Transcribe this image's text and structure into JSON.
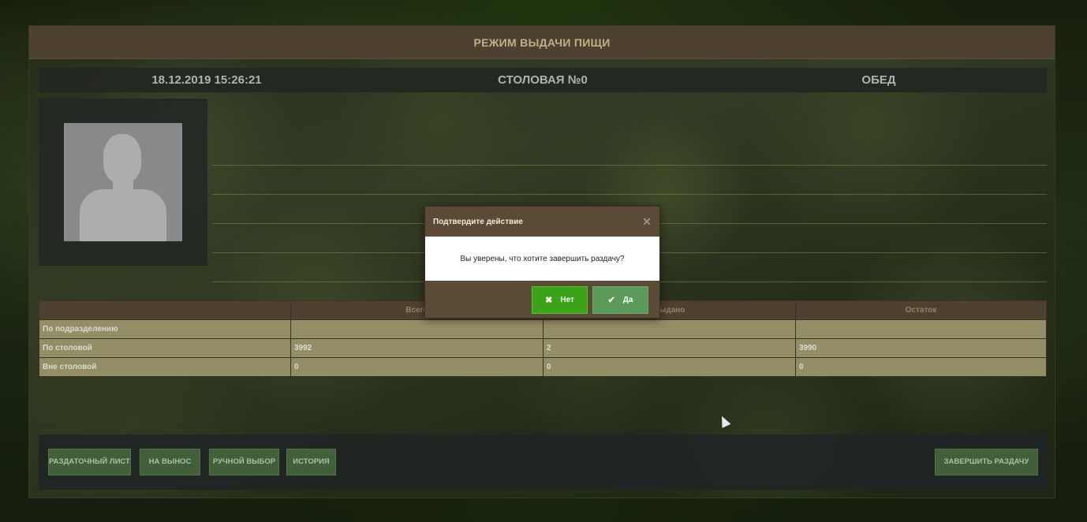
{
  "app": {
    "title": "РЕЖИМ ВЫДАЧИ ПИЩИ"
  },
  "info_bar": {
    "datetime": "18.12.2019 15:26:21",
    "canteen": "СТОЛОВАЯ №0",
    "meal": "ОБЕД"
  },
  "photo": {
    "icon": "user-silhouette-icon"
  },
  "table": {
    "headers": [
      "",
      "Всего",
      "Выдано",
      "Остаток"
    ],
    "rows": [
      {
        "label": "По подразделению",
        "total": "",
        "issued": "",
        "remainder": ""
      },
      {
        "label": "По столовой",
        "total": "3992",
        "issued": "2",
        "remainder": "3990"
      },
      {
        "label": "Вне столовой",
        "total": "0",
        "issued": "0",
        "remainder": "0"
      }
    ]
  },
  "buttons": {
    "distribution_sheet": "РАЗДАТОЧНЫЙ ЛИСТ",
    "takeaway": "НА ВЫНОС",
    "manual_select": "РУЧНОЙ ВЫБОР",
    "history": "ИСТОРИЯ",
    "finish": "ЗАВЕРШИТЬ РАЗДАЧУ"
  },
  "modal": {
    "title": "Подтвердите действие",
    "close_icon": "close-icon",
    "message": "Вы уверены, что хотите завершить раздачу?",
    "no_label": "Нет",
    "no_icon": "cross-icon",
    "yes_label": "Да",
    "yes_icon": "check-icon"
  },
  "colors": {
    "header_brown": "#5b4a36",
    "table_olive": "#a9a275",
    "button_green": "#4a6e43",
    "no_green": "#3aa317",
    "yes_green": "#5c9a5a"
  }
}
